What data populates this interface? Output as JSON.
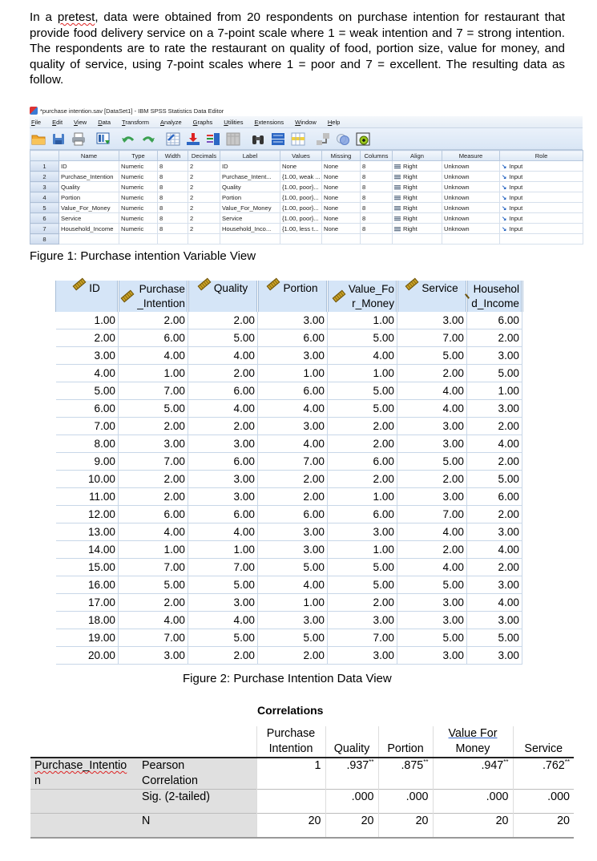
{
  "intro": {
    "squiggle_word": "pretest",
    "before": "In a ",
    "after": ", data were obtained from 20 respondents on purchase intention for restaurant that provide food delivery service on a 7-point scale where 1 = weak intention and 7 = strong intention. The respondents are to rate the restaurant on quality of food, portion size, value for money, and quality of service, using 7-point scales where 1 = poor and 7 = excellent. The resulting data as follow."
  },
  "spss": {
    "title": "*purchase intention.sav [DataSet1] - IBM SPSS Statistics Data Editor",
    "menu": [
      "File",
      "Edit",
      "View",
      "Data",
      "Transform",
      "Analyze",
      "Graphs",
      "Utilities",
      "Extensions",
      "Window",
      "Help"
    ],
    "toolbar_icons": [
      "open-folder-icon",
      "save-icon",
      "print-icon",
      "recall-dialog-icon",
      "undo-icon",
      "redo-icon",
      "goto-case-icon",
      "goto-variable-icon",
      "variables-icon",
      "run-descriptives-icon",
      "find-icon",
      "split-file-icon",
      "select-cases-icon",
      "value-labels-icon",
      "use-sets-icon",
      "show-all-variables-icon"
    ],
    "variable_view": {
      "columns": [
        "",
        "Name",
        "Type",
        "Width",
        "Decimals",
        "Label",
        "Values",
        "Missing",
        "Columns",
        "Align",
        "Measure",
        "Role"
      ],
      "rows": [
        {
          "n": "1",
          "name": "ID",
          "type": "Numeric",
          "width": "8",
          "decimals": "2",
          "label": "ID",
          "values": "None",
          "missing": "None",
          "columns": "8",
          "align": "Right",
          "measure": "Unknown",
          "role": "Input"
        },
        {
          "n": "2",
          "name": "Purchase_Intention",
          "type": "Numeric",
          "width": "8",
          "decimals": "2",
          "label": "Purchase_Intent...",
          "values": "{1.00, weak ...",
          "missing": "None",
          "columns": "8",
          "align": "Right",
          "measure": "Unknown",
          "role": "Input"
        },
        {
          "n": "3",
          "name": "Quality",
          "type": "Numeric",
          "width": "8",
          "decimals": "2",
          "label": "Quality",
          "values": "{1.00, poor}...",
          "missing": "None",
          "columns": "8",
          "align": "Right",
          "measure": "Unknown",
          "role": "Input"
        },
        {
          "n": "4",
          "name": "Portion",
          "type": "Numeric",
          "width": "8",
          "decimals": "2",
          "label": "Portion",
          "values": "{1.00, poor}...",
          "missing": "None",
          "columns": "8",
          "align": "Right",
          "measure": "Unknown",
          "role": "Input"
        },
        {
          "n": "5",
          "name": "Value_For_Money",
          "type": "Numeric",
          "width": "8",
          "decimals": "2",
          "label": "Value_For_Money",
          "values": "{1.00, poor}...",
          "missing": "None",
          "columns": "8",
          "align": "Right",
          "measure": "Unknown",
          "role": "Input"
        },
        {
          "n": "6",
          "name": "Service",
          "type": "Numeric",
          "width": "8",
          "decimals": "2",
          "label": "Service",
          "values": "{1.00, poor}...",
          "missing": "None",
          "columns": "8",
          "align": "Right",
          "measure": "Unknown",
          "role": "Input"
        },
        {
          "n": "7",
          "name": "Household_Income",
          "type": "Numeric",
          "width": "8",
          "decimals": "2",
          "label": "Household_Inco...",
          "values": "{1.00, less t...",
          "missing": "None",
          "columns": "8",
          "align": "Right",
          "measure": "Unknown",
          "role": "Input"
        },
        {
          "n": "8",
          "name": "",
          "type": "",
          "width": "",
          "decimals": "",
          "label": "",
          "values": "",
          "missing": "",
          "columns": "",
          "align": "",
          "measure": "",
          "role": ""
        }
      ]
    }
  },
  "figure1_caption": "Figure 1: Purchase intention Variable View",
  "data_view": {
    "columns": [
      {
        "line1": "ID",
        "line2": ""
      },
      {
        "line1": "Purchase",
        "line2": "_Intention"
      },
      {
        "line1": "Quality",
        "line2": ""
      },
      {
        "line1": "Portion",
        "line2": ""
      },
      {
        "line1": "Value_Fo",
        "line2": "r_Money"
      },
      {
        "line1": "Service",
        "line2": ""
      },
      {
        "line1": "Househol",
        "line2": "d_Income"
      }
    ],
    "rows": [
      [
        "1.00",
        "2.00",
        "2.00",
        "3.00",
        "1.00",
        "3.00",
        "6.00"
      ],
      [
        "2.00",
        "6.00",
        "5.00",
        "6.00",
        "5.00",
        "7.00",
        "2.00"
      ],
      [
        "3.00",
        "4.00",
        "4.00",
        "3.00",
        "4.00",
        "5.00",
        "3.00"
      ],
      [
        "4.00",
        "1.00",
        "2.00",
        "1.00",
        "1.00",
        "2.00",
        "5.00"
      ],
      [
        "5.00",
        "7.00",
        "6.00",
        "6.00",
        "5.00",
        "4.00",
        "1.00"
      ],
      [
        "6.00",
        "5.00",
        "4.00",
        "4.00",
        "5.00",
        "4.00",
        "3.00"
      ],
      [
        "7.00",
        "2.00",
        "2.00",
        "3.00",
        "2.00",
        "3.00",
        "2.00"
      ],
      [
        "8.00",
        "3.00",
        "3.00",
        "4.00",
        "2.00",
        "3.00",
        "4.00"
      ],
      [
        "9.00",
        "7.00",
        "6.00",
        "7.00",
        "6.00",
        "5.00",
        "2.00"
      ],
      [
        "10.00",
        "2.00",
        "3.00",
        "2.00",
        "2.00",
        "2.00",
        "5.00"
      ],
      [
        "11.00",
        "2.00",
        "3.00",
        "2.00",
        "1.00",
        "3.00",
        "6.00"
      ],
      [
        "12.00",
        "6.00",
        "6.00",
        "6.00",
        "6.00",
        "7.00",
        "2.00"
      ],
      [
        "13.00",
        "4.00",
        "4.00",
        "3.00",
        "3.00",
        "4.00",
        "3.00"
      ],
      [
        "14.00",
        "1.00",
        "1.00",
        "3.00",
        "1.00",
        "2.00",
        "4.00"
      ],
      [
        "15.00",
        "7.00",
        "7.00",
        "5.00",
        "5.00",
        "4.00",
        "2.00"
      ],
      [
        "16.00",
        "5.00",
        "5.00",
        "4.00",
        "5.00",
        "5.00",
        "3.00"
      ],
      [
        "17.00",
        "2.00",
        "3.00",
        "1.00",
        "2.00",
        "3.00",
        "4.00"
      ],
      [
        "18.00",
        "4.00",
        "4.00",
        "3.00",
        "3.00",
        "3.00",
        "3.00"
      ],
      [
        "19.00",
        "7.00",
        "5.00",
        "5.00",
        "7.00",
        "5.00",
        "5.00"
      ],
      [
        "20.00",
        "3.00",
        "2.00",
        "2.00",
        "3.00",
        "3.00",
        "3.00"
      ]
    ]
  },
  "figure2_caption": "Figure 2: Purchase Intention Data View",
  "correlations": {
    "title": "Correlations",
    "headers": [
      {
        "line1": "Purchase",
        "line2": "Intention"
      },
      {
        "line1": "",
        "line2": "Quality"
      },
      {
        "line1": "",
        "line2": "Portion"
      },
      {
        "line1": "Value For",
        "line2": "Money"
      },
      {
        "line1": "",
        "line2": "Service"
      }
    ],
    "row_label_line1": "Purchase_Intentio",
    "row_label_line2": "n",
    "stats": [
      {
        "label_line1": "Pearson",
        "label_line2": "Correlation",
        "values": [
          "1",
          ".937",
          ".875",
          ".947",
          ".762"
        ],
        "sig_marks": [
          "",
          "**",
          "**",
          "**",
          "**"
        ]
      },
      {
        "label_line1": "Sig. (2-tailed)",
        "label_line2": "",
        "values": [
          "",
          ".000",
          ".000",
          ".000",
          ".000"
        ],
        "sig_marks": [
          "",
          "",
          "",
          "",
          ""
        ]
      },
      {
        "label_line1": "N",
        "label_line2": "",
        "values": [
          "20",
          "20",
          "20",
          "20",
          "20"
        ],
        "sig_marks": [
          "",
          "",
          "",
          "",
          ""
        ]
      }
    ]
  }
}
